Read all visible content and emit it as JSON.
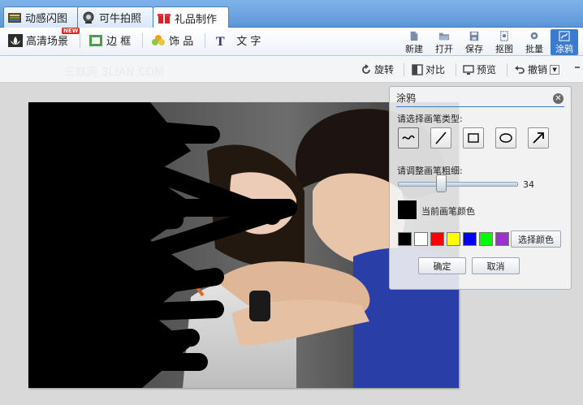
{
  "tabs": [
    {
      "label": "动感闪图",
      "icon": "film-strip-icon",
      "active": false
    },
    {
      "label": "可牛拍照",
      "icon": "webcam-icon",
      "active": false
    },
    {
      "label": "礼品制作",
      "icon": "gift-icon",
      "active": true
    }
  ],
  "main_tools": [
    {
      "label": "高清场景",
      "icon": "lotus-icon",
      "badge": "NEW"
    },
    {
      "label": "边 框",
      "icon": "frame-icon"
    },
    {
      "label": "饰 品",
      "icon": "flower-accessory-icon"
    },
    {
      "label": "文 字",
      "icon": "text-t-icon"
    }
  ],
  "file_actions": [
    {
      "label": "新建",
      "icon": "new-document-icon"
    },
    {
      "label": "打开",
      "icon": "open-folder-icon"
    },
    {
      "label": "保存",
      "icon": "floppy-save-icon"
    },
    {
      "label": "抠图",
      "icon": "cutout-icon"
    },
    {
      "label": "批量",
      "icon": "batch-gear-icon"
    },
    {
      "label": "涂鸦",
      "icon": "doodle-icon",
      "active": true
    }
  ],
  "edit_tools": {
    "watermark": "三联网 3LIAN.COM",
    "rotate": "旋转",
    "compare": "对比",
    "preview": "预览",
    "undo": "撤销"
  },
  "doodle_panel": {
    "title": "涂鸦",
    "brush_type_label": "请选择画笔类型:",
    "brush_types": [
      "curve",
      "line",
      "rectangle",
      "ellipse",
      "arrow"
    ],
    "selected_brush": "curve",
    "thickness_label": "请调整画笔粗细:",
    "thickness_value": "34",
    "thickness_fraction": 0.36,
    "current_color_label": "当前画笔颜色",
    "current_color": "#000000",
    "palette": [
      "#000000",
      "#ffffff",
      "#ff0000",
      "#ffff00",
      "#0000ff",
      "#00ff00",
      "#9933cc"
    ],
    "choose_color_button": "选择颜色",
    "ok_button": "确定",
    "cancel_button": "取消"
  },
  "colors": {
    "accent": "#3a7bd0",
    "tab_bar": "#6aa3e2"
  }
}
